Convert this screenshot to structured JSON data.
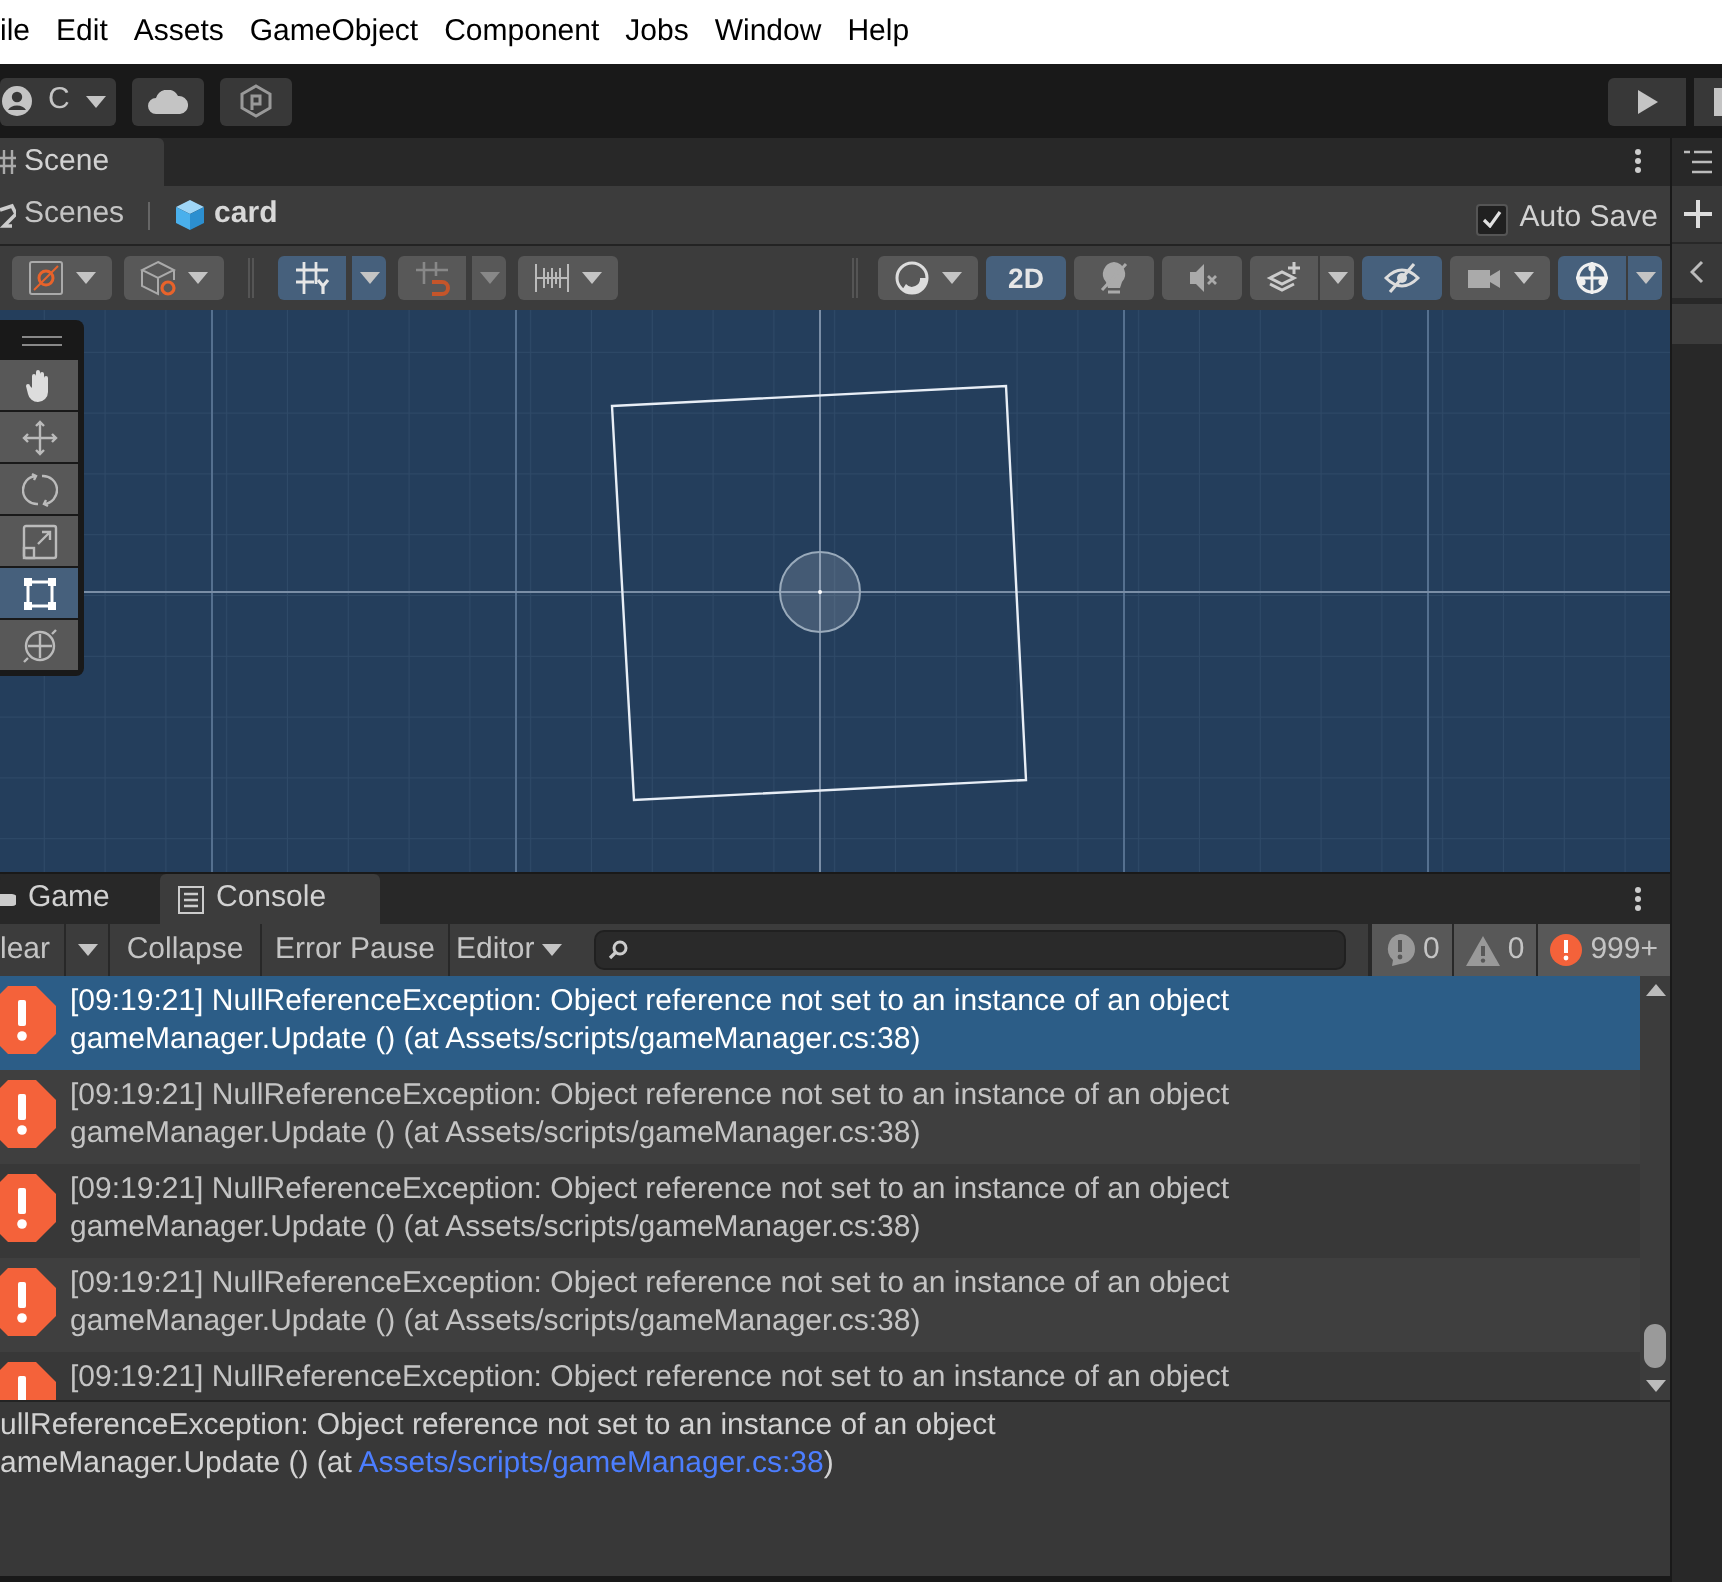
{
  "menu_bar": {
    "items": [
      "ile",
      "Edit",
      "Assets",
      "GameObject",
      "Component",
      "Jobs",
      "Window",
      "Help"
    ]
  },
  "toolbar": {
    "account": {
      "label": "C"
    }
  },
  "scene_panel": {
    "tab": {
      "label": "Scene",
      "selected": true
    },
    "breadcrumb": [
      "Scenes",
      "card"
    ],
    "auto_save": {
      "label": "Auto Save",
      "checked": true
    },
    "scene_buttons": [
      {
        "on": false
      },
      {
        "on": false
      },
      {
        "on": true
      },
      {
        "on": false
      },
      {
        "on": false
      },
      {
        "on": false
      },
      {
        "label": "2D",
        "on": true
      },
      {
        "on": false
      },
      {
        "on": false
      },
      {
        "on": false
      },
      {
        "on": true
      },
      {
        "on": false
      },
      {
        "on": true
      }
    ],
    "tools": [
      {
        "selected": false
      },
      {
        "selected": false
      },
      {
        "selected": false
      },
      {
        "selected": false
      },
      {
        "selected": true
      },
      {
        "selected": false
      }
    ]
  },
  "console_panel": {
    "tabs": [
      {
        "label": "Game",
        "selected": false
      },
      {
        "label": "Console",
        "selected": true
      }
    ],
    "toolbar": {
      "clear": "lear",
      "collapse": "Collapse",
      "error_pause": "Error Pause",
      "editor": "Editor"
    },
    "counts": [
      {
        "kind": "info",
        "count": "0"
      },
      {
        "kind": "warning",
        "count": "0"
      },
      {
        "kind": "error",
        "count": "999+"
      }
    ],
    "logs": [
      {
        "line1": "[09:19:21] NullReferenceException: Object reference not set to an instance of an object",
        "line2": "gameManager.Update () (at Assets/scripts/gameManager.cs:38)",
        "selected": true
      },
      {
        "line1": "[09:19:21] NullReferenceException: Object reference not set to an instance of an object",
        "line2": "gameManager.Update () (at Assets/scripts/gameManager.cs:38)",
        "selected": false
      },
      {
        "line1": "[09:19:21] NullReferenceException: Object reference not set to an instance of an object",
        "line2": "gameManager.Update () (at Assets/scripts/gameManager.cs:38)",
        "selected": false
      },
      {
        "line1": "[09:19:21] NullReferenceException: Object reference not set to an instance of an object",
        "line2": "gameManager.Update () (at Assets/scripts/gameManager.cs:38)",
        "selected": false
      },
      {
        "line1": "[09:19:21] NullReferenceException: Object reference not set to an instance of an object",
        "selected": false
      }
    ],
    "detail": {
      "line1": "ullReferenceException: Object reference not set to an instance of an object",
      "line2": "ameManager.Update () (at ",
      "link": "Assets/scripts/gameManager.cs:38",
      "line2_end": ")"
    }
  }
}
